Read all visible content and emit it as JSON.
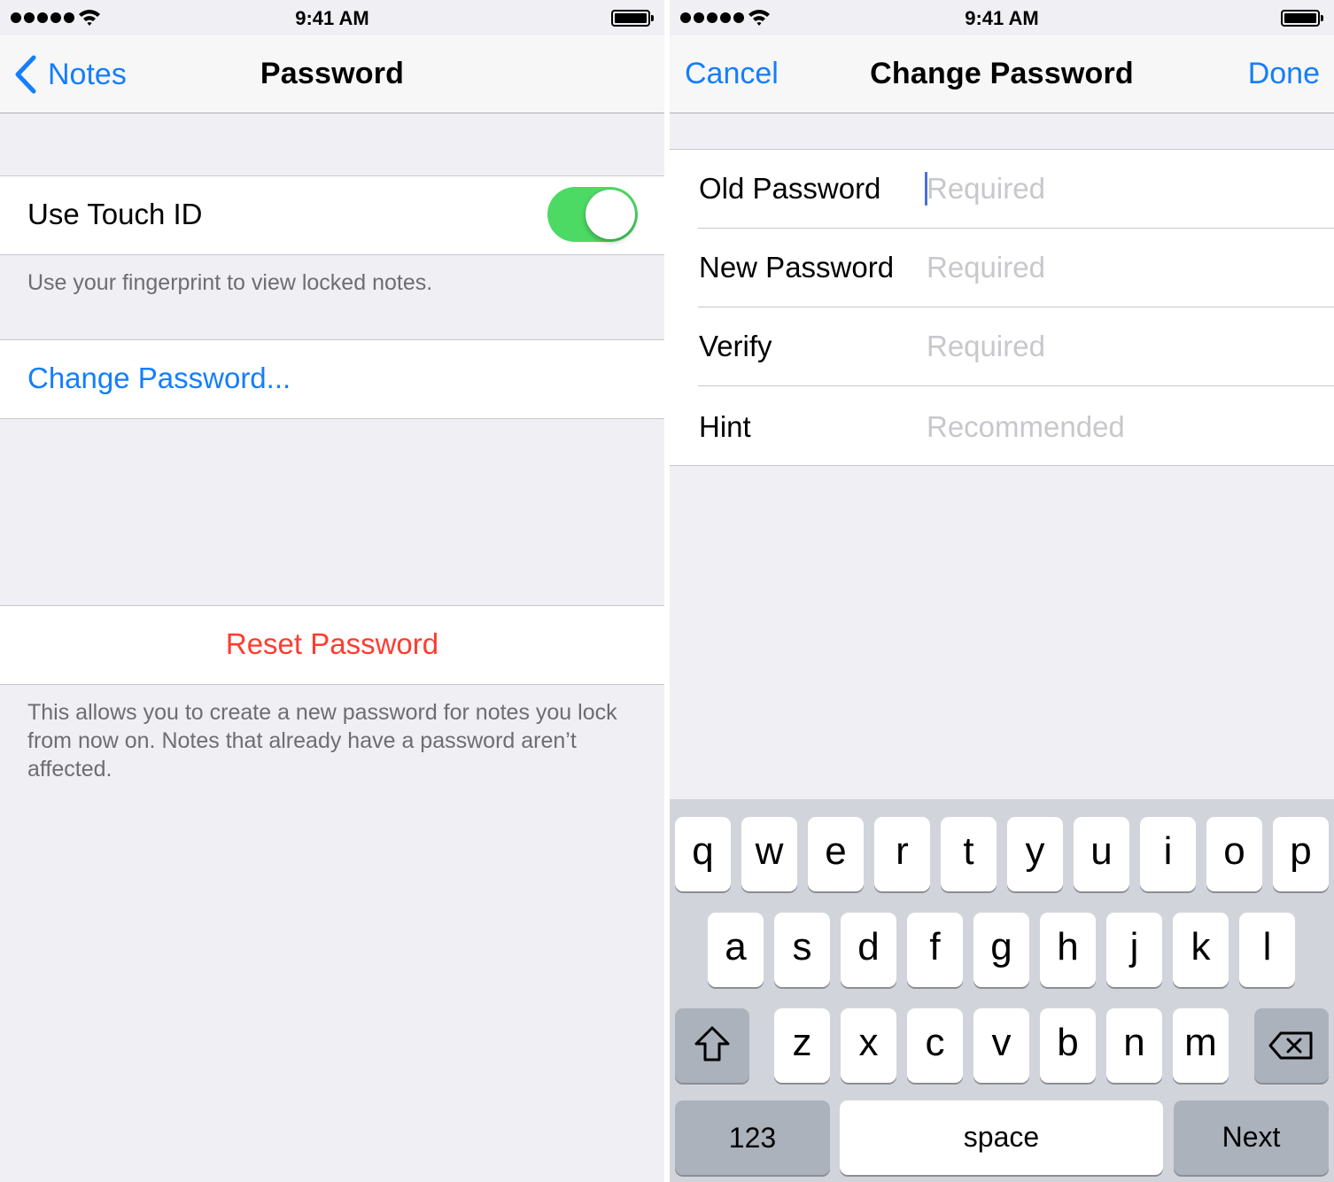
{
  "left": {
    "status": {
      "time": "9:41 AM"
    },
    "nav": {
      "back_label": "Notes",
      "title": "Password"
    },
    "touch_id": {
      "label": "Use Touch ID",
      "enabled": true,
      "footer": "Use your fingerprint to view locked notes."
    },
    "change_password_label": "Change Password...",
    "reset": {
      "label": "Reset Password",
      "footer": "This allows you to create a new password for notes you lock from now on. Notes that already have a password aren’t affected."
    },
    "colors": {
      "accent": "#157efb",
      "destructive": "#ff3b30",
      "switch_on": "#4cd964",
      "background": "#efeff4"
    }
  },
  "right": {
    "status": {
      "time": "9:41 AM"
    },
    "nav": {
      "cancel_label": "Cancel",
      "title": "Change Password",
      "done_label": "Done"
    },
    "fields": [
      {
        "label": "Old Password",
        "placeholder": "Required",
        "focused": true
      },
      {
        "label": "New Password",
        "placeholder": "Required"
      },
      {
        "label": "Verify",
        "placeholder": "Required"
      },
      {
        "label": "Hint",
        "placeholder": "Recommended"
      }
    ],
    "keyboard": {
      "row1": [
        "q",
        "w",
        "e",
        "r",
        "t",
        "y",
        "u",
        "i",
        "o",
        "p"
      ],
      "row2": [
        "a",
        "s",
        "d",
        "f",
        "g",
        "h",
        "j",
        "k",
        "l"
      ],
      "row3": [
        "z",
        "x",
        "c",
        "v",
        "b",
        "n",
        "m"
      ],
      "numbers_label": "123",
      "space_label": "space",
      "return_label": "Next",
      "icons": {
        "shift": "shift-icon",
        "delete": "delete-icon"
      }
    }
  }
}
